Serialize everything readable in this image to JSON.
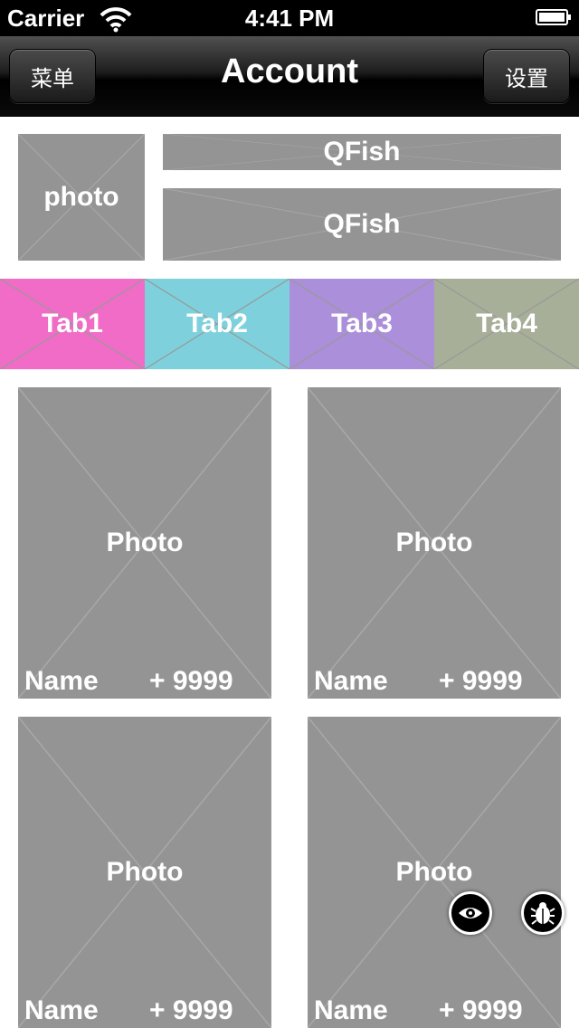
{
  "status": {
    "carrier": "Carrier",
    "time": "4:41 PM"
  },
  "nav": {
    "left_label": "菜单",
    "title": "Account",
    "right_label": "设置"
  },
  "profile": {
    "photo_label": "photo",
    "name_label": "QFish",
    "subtitle_label": "QFish"
  },
  "tabs": [
    {
      "label": "Tab1",
      "color": "#f06cc6"
    },
    {
      "label": "Tab2",
      "color": "#7ed1dc"
    },
    {
      "label": "Tab3",
      "color": "#ab8fda"
    },
    {
      "label": "Tab4",
      "color": "#a7af98"
    }
  ],
  "cards": [
    {
      "photo": "Photo",
      "name": "Name",
      "count": "+ 9999"
    },
    {
      "photo": "Photo",
      "name": "Name",
      "count": "+ 9999"
    },
    {
      "photo": "Photo",
      "name": "Name",
      "count": "+ 9999"
    },
    {
      "photo": "Photo",
      "name": "Name",
      "count": "+ 9999"
    }
  ],
  "colors": {
    "placeholder": "#949494",
    "placeholder_cross": "#a8a8a8"
  },
  "icons": {
    "eye": "eye-icon",
    "bug": "bug-icon"
  }
}
